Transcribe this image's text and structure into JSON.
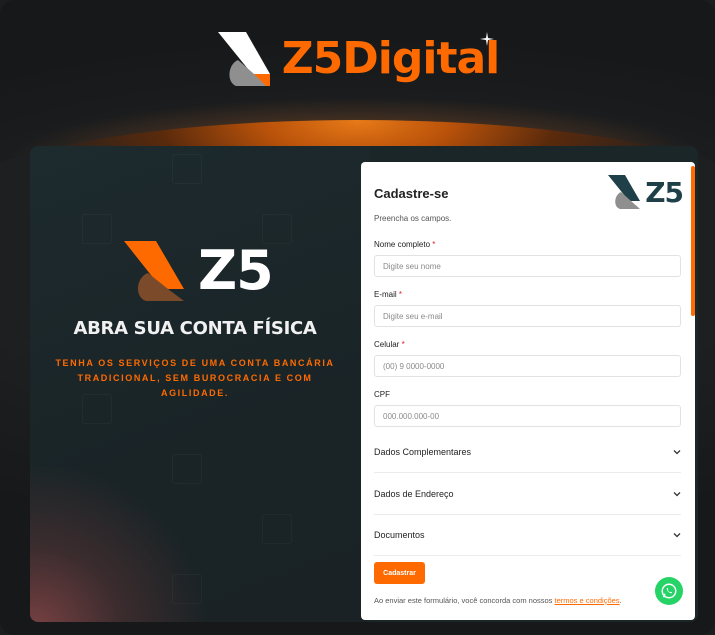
{
  "brand": {
    "name": "Z5Digital",
    "colors": {
      "orange": "#ff6a00",
      "dark": "#1f4048",
      "gray": "#8f8f8f"
    }
  },
  "hero": {
    "logo_text": "Z5",
    "headline": "ABRA SUA CONTA FÍSICA",
    "tagline": "TENHA OS SERVIÇOS DE UMA CONTA BANCÁRIA TRADICIONAL, SEM BUROCRACIA E COM AGILIDADE."
  },
  "form": {
    "logo_text": "Z5",
    "title": "Cadastre-se",
    "subtitle": "Preencha os campos.",
    "fields": [
      {
        "label": "Nome completo",
        "required": "*",
        "placeholder": "Digite seu nome",
        "value": ""
      },
      {
        "label": "E-mail",
        "required": "*",
        "placeholder": "Digite seu e-mail",
        "value": ""
      },
      {
        "label": "Celular",
        "required": "*",
        "placeholder": "(00) 9 0000-0000",
        "value": ""
      },
      {
        "label": "CPF",
        "required": "",
        "placeholder": "000.000.000-00",
        "value": ""
      }
    ],
    "sections": [
      {
        "label": "Dados Complementares",
        "icon": "chevron-down-icon"
      },
      {
        "label": "Dados de Endereço",
        "icon": "chevron-down-icon"
      },
      {
        "label": "Documentos",
        "icon": "chevron-down-icon"
      }
    ],
    "submit_label": "Cadastrar",
    "terms_text": "Ao enviar este formulário, você concorda com nossos ",
    "terms_link": "termos e condições",
    "terms_end": "."
  },
  "whatsapp": {
    "icon": "whatsapp-icon",
    "color": "#25d366"
  }
}
